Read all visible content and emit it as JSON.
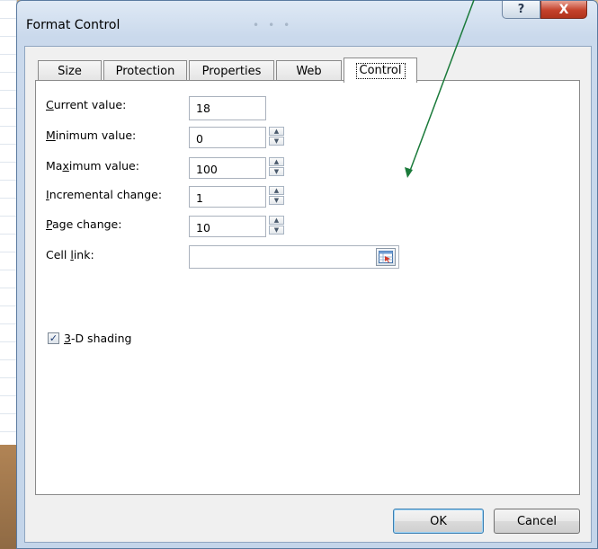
{
  "dialog": {
    "title": "Format Control",
    "help_glyph": "?",
    "close_glyph": "X"
  },
  "tabs": [
    {
      "label": "Size"
    },
    {
      "label": "Protection"
    },
    {
      "label": "Properties"
    },
    {
      "label": "Web"
    },
    {
      "label": "Control",
      "active": true
    }
  ],
  "fields": {
    "current_value": {
      "label_pre": "",
      "label_key": "C",
      "label_post": "urrent value:",
      "value": "18"
    },
    "minimum_value": {
      "label_pre": "",
      "label_key": "M",
      "label_post": "inimum value:",
      "value": "0"
    },
    "maximum_value": {
      "label_pre": "Ma",
      "label_key": "x",
      "label_post": "imum value:",
      "value": "100"
    },
    "incremental_change": {
      "label_pre": "",
      "label_key": "I",
      "label_post": "ncremental change:",
      "value": "1"
    },
    "page_change": {
      "label_pre": "",
      "label_key": "P",
      "label_post": "age change:",
      "value": "10"
    },
    "cell_link": {
      "label_pre": "Cell ",
      "label_key": "l",
      "label_post": "ink:",
      "value": ""
    }
  },
  "shading": {
    "label_key": "3",
    "label_post": "-D shading",
    "checked": true,
    "check_glyph": "✓"
  },
  "buttons": {
    "ok": "OK",
    "cancel": "Cancel"
  },
  "spin_glyphs": {
    "up": "▲",
    "down": "▼"
  },
  "colors": {
    "annotation_arrow": "#1a7a3a",
    "dialog_frame": "#c4d5ea",
    "close_button": "#c4422b"
  }
}
